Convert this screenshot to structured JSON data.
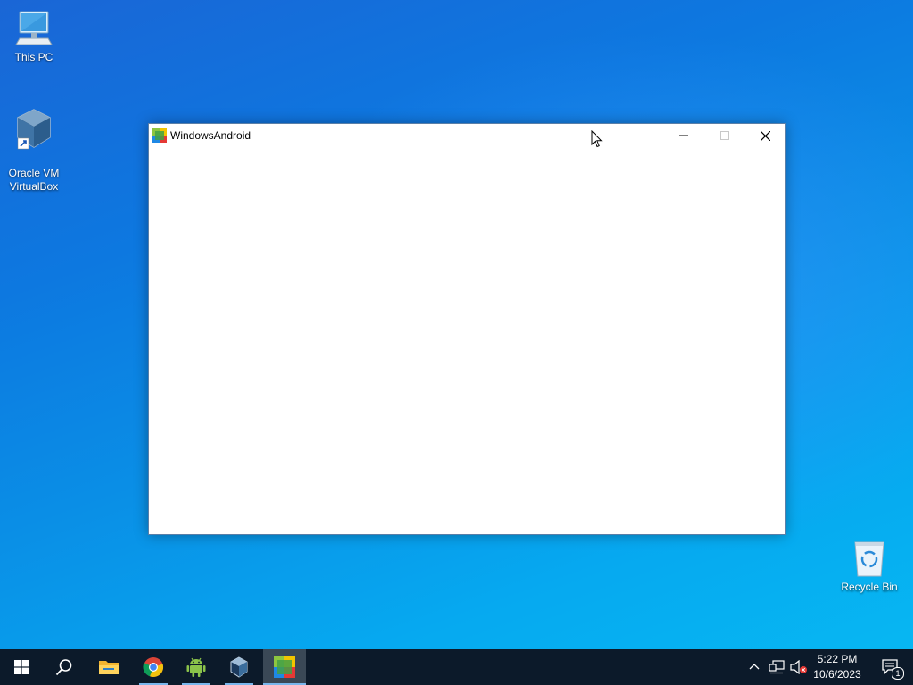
{
  "desktop": {
    "icons": [
      {
        "label": "This PC",
        "icon": "computer-icon"
      },
      {
        "label": "Oracle VM\nVirtualBox",
        "icon": "virtualbox-icon"
      },
      {
        "label": "Recycle Bin",
        "icon": "recycle-bin-icon"
      }
    ]
  },
  "window": {
    "title": "WindowsAndroid",
    "icon": "windowsandroid-app-icon",
    "controls": [
      "minimize-icon",
      "maximize-icon",
      "close-icon"
    ]
  },
  "taskbar": {
    "buttons": [
      {
        "name": "start-button",
        "icon": "windows-logo-icon"
      },
      {
        "name": "search-button",
        "icon": "search-icon"
      },
      {
        "name": "file-explorer-button",
        "icon": "folder-icon"
      },
      {
        "name": "chrome-button",
        "icon": "chrome-icon",
        "running": true
      },
      {
        "name": "android-app-button",
        "icon": "android-icon",
        "running": true
      },
      {
        "name": "virtualbox-button",
        "icon": "virtualbox-icon",
        "running": true
      },
      {
        "name": "windowsandroid-button",
        "icon": "windowsandroid-app-icon",
        "running": true,
        "active": true
      }
    ],
    "tray": {
      "icons": [
        "chevron-up-icon",
        "network-icon",
        "volume-muted-icon"
      ],
      "time": "5:22 PM",
      "date": "10/6/2023",
      "notification_count": "1"
    }
  },
  "colors": {
    "taskbar": "#0c1a2a",
    "accent": "#78b6ec"
  }
}
